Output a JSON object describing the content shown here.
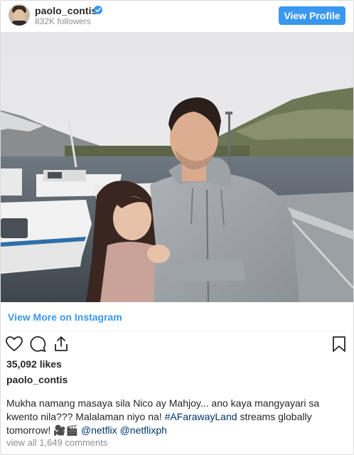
{
  "header": {
    "username": "paolo_contis",
    "followers": "832K followers",
    "view_profile_label": "View Profile"
  },
  "post": {
    "view_more_label": "View More on Instagram",
    "likes": "35,092 likes",
    "caption_user": "paolo_contis",
    "caption_text": "Mukha namang masaya sila Nico ay Mahjoy... ano kaya mangyayari sa kwento nila??? Malalaman niyo na!",
    "hashtag": "#AFarawayLand",
    "caption_after_hashtag": "streams globally tomorrow! 🎥🎬",
    "mention_1": "@netflix",
    "mention_2": "@netflixph",
    "comments_link": "view all 1,649 comments"
  },
  "icons": [
    "verified-badge-icon",
    "heart-icon",
    "comment-icon",
    "share-icon",
    "bookmark-icon"
  ],
  "colors": {
    "accent_blue": "#3897f0",
    "text": "#262626",
    "muted": "#8e8e8e",
    "hashtag": "#003569"
  }
}
